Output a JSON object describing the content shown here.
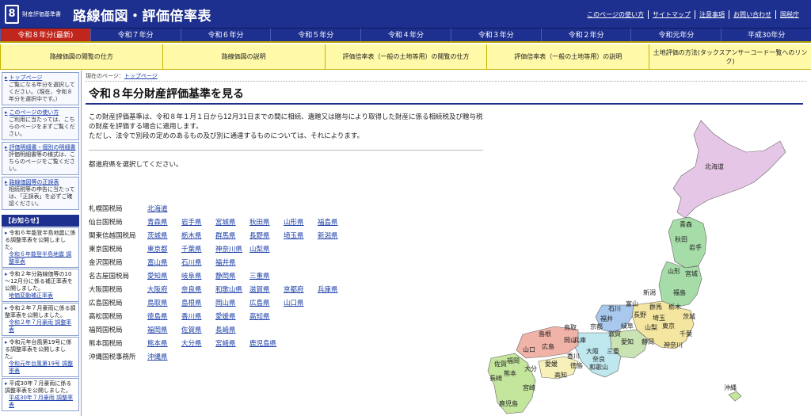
{
  "header": {
    "logo": "8",
    "site_sub": "財産評価基準書",
    "site_title": "路線価図・評価倍率表",
    "util_links": [
      "このページの使い方",
      "サイトマップ",
      "注意事項",
      "お問い合わせ",
      "国税庁"
    ]
  },
  "years": [
    "令和８年分(最新)",
    "令和７年分",
    "令和６年分",
    "令和５年分",
    "令和４年分",
    "令和３年分",
    "令和２年分",
    "令和元年分",
    "平成30年分"
  ],
  "guides": [
    "路線価図の閲覧の仕方",
    "路線価図の説明",
    "評価倍率表（一般の土地等用）の閲覧の仕方",
    "評価倍率表（一般の土地等用）の説明",
    "土地評価の方法(タックスアンサーコード一覧へのリンク)"
  ],
  "sidebar": {
    "boxes": [
      {
        "head": "トップページ",
        "text": "ご覧になる年分を選択してください。（現在、令和８年分を選択中です。）"
      },
      {
        "head": "このページの使い方",
        "text": "ご利用に当たっては、こちらのページをまずご覧ください。"
      },
      {
        "head": "評価明細書・個別の明細書",
        "text": "評価明細書等の様式は、こちらのページをご覧ください。"
      },
      {
        "head": "路線価図等の正誤表",
        "text": "相続税等の申告に当たっては、「正誤表」を必ずご確認ください。"
      }
    ],
    "news_title": "【お知らせ】",
    "news": [
      {
        "text": "令和６年能登半島地震に係る調整率表を公開しました。",
        "link": "令和６年能登半島地震 調整率表"
      },
      {
        "text": "令和２年分路線価等の10～12月分に係る補正率表を公開しました。",
        "link": "地価変動補正率表"
      },
      {
        "text": "令和２年７月豪雨に係る調整率表を公開しました。",
        "link": "令和２年７月豪雨 調整率表"
      },
      {
        "text": "令和元年台風第19号に係る調整率表を公開しました。",
        "link": "令和元年台風第19号 調整率表"
      },
      {
        "text": "平成30年７月豪雨に係る調整率表を公開しました。",
        "link": "平成30年７月豪雨 調整率表"
      }
    ]
  },
  "breadcrumb": {
    "label": "現在のページ：",
    "link": "トップページ"
  },
  "page_title": "令和８年分財産評価基準を見る",
  "intro": [
    "この財産評価基準は、令和８年１月１日から12月31日までの間に相続、遺贈又は贈与により取得した財産に係る相続税及び贈与税の財産を評価する場合に適用します。",
    "ただし、法令で別段の定めのあるもの及び別に通達するものについては、それによります。"
  ],
  "select_text": "都道府県を選択してください。",
  "bureaus": [
    {
      "name": "札幌国税局",
      "prefs": [
        "北海道"
      ]
    },
    {
      "name": "仙台国税局",
      "prefs": [
        "青森県",
        "岩手県",
        "宮城県",
        "秋田県",
        "山形県",
        "福島県"
      ]
    },
    {
      "name": "関東信越国税局",
      "prefs": [
        "茨城県",
        "栃木県",
        "群馬県",
        "長野県",
        "埼玉県",
        "新潟県"
      ]
    },
    {
      "name": "東京国税局",
      "prefs": [
        "東京都",
        "千葉県",
        "神奈川県",
        "山梨県"
      ]
    },
    {
      "name": "金沢国税局",
      "prefs": [
        "富山県",
        "石川県",
        "福井県"
      ]
    },
    {
      "name": "名古屋国税局",
      "prefs": [
        "愛知県",
        "岐阜県",
        "静岡県",
        "三重県"
      ]
    },
    {
      "name": "大阪国税局",
      "prefs": [
        "大阪府",
        "奈良県",
        "和歌山県",
        "滋賀県",
        "京都府",
        "兵庫県"
      ]
    },
    {
      "name": "広島国税局",
      "prefs": [
        "鳥取県",
        "島根県",
        "岡山県",
        "広島県",
        "山口県"
      ]
    },
    {
      "name": "高松国税局",
      "prefs": [
        "徳島県",
        "香川県",
        "愛媛県",
        "高知県"
      ]
    },
    {
      "name": "福岡国税局",
      "prefs": [
        "福岡県",
        "佐賀県",
        "長崎県"
      ]
    },
    {
      "name": "熊本国税局",
      "prefs": [
        "熊本県",
        "大分県",
        "宮崎県",
        "鹿児島県"
      ]
    },
    {
      "name": "沖縄国税事務所",
      "prefs": [
        "沖縄県"
      ]
    }
  ],
  "map_labels": {
    "hokkaido": "北海道",
    "aomori": "青森",
    "akita": "秋田",
    "iwate": "岩手",
    "yamagata": "山形",
    "miyagi": "宮城",
    "niigata": "新潟",
    "fukushima": "福島",
    "toyama": "富山",
    "ishikawa": "石川",
    "gunma": "群馬",
    "tochigi": "栃木",
    "ibaraki": "茨城",
    "nagano": "長野",
    "saitama": "埼玉",
    "fukui": "福井",
    "yamanashi": "山梨",
    "tokyo": "東京",
    "chiba": "千葉",
    "kanagawa": "神奈川",
    "gifu": "岐阜",
    "shizuoka": "静岡",
    "aichi": "愛知",
    "shiga": "滋賀",
    "kyoto": "京都",
    "mie": "三重",
    "hyogo": "兵庫",
    "osaka": "大阪",
    "nara": "奈良",
    "wakayama": "和歌山",
    "tottori": "鳥取",
    "shimane": "島根",
    "okayama": "岡山",
    "hiroshima": "広島",
    "yamaguchi": "山口",
    "kagawa": "香川",
    "tokushima": "徳島",
    "ehime": "愛媛",
    "kochi": "高知",
    "fukuoka": "福岡",
    "saga": "佐賀",
    "nagasaki": "長崎",
    "oita": "大分",
    "kumamoto": "熊本",
    "miyazaki": "宮崎",
    "kagoshima": "鹿児島",
    "okinawa": "沖縄"
  },
  "colors": {
    "header": "#1d2f8f",
    "active_year": "#c0261c",
    "guide_bg": "#fff9a8"
  }
}
